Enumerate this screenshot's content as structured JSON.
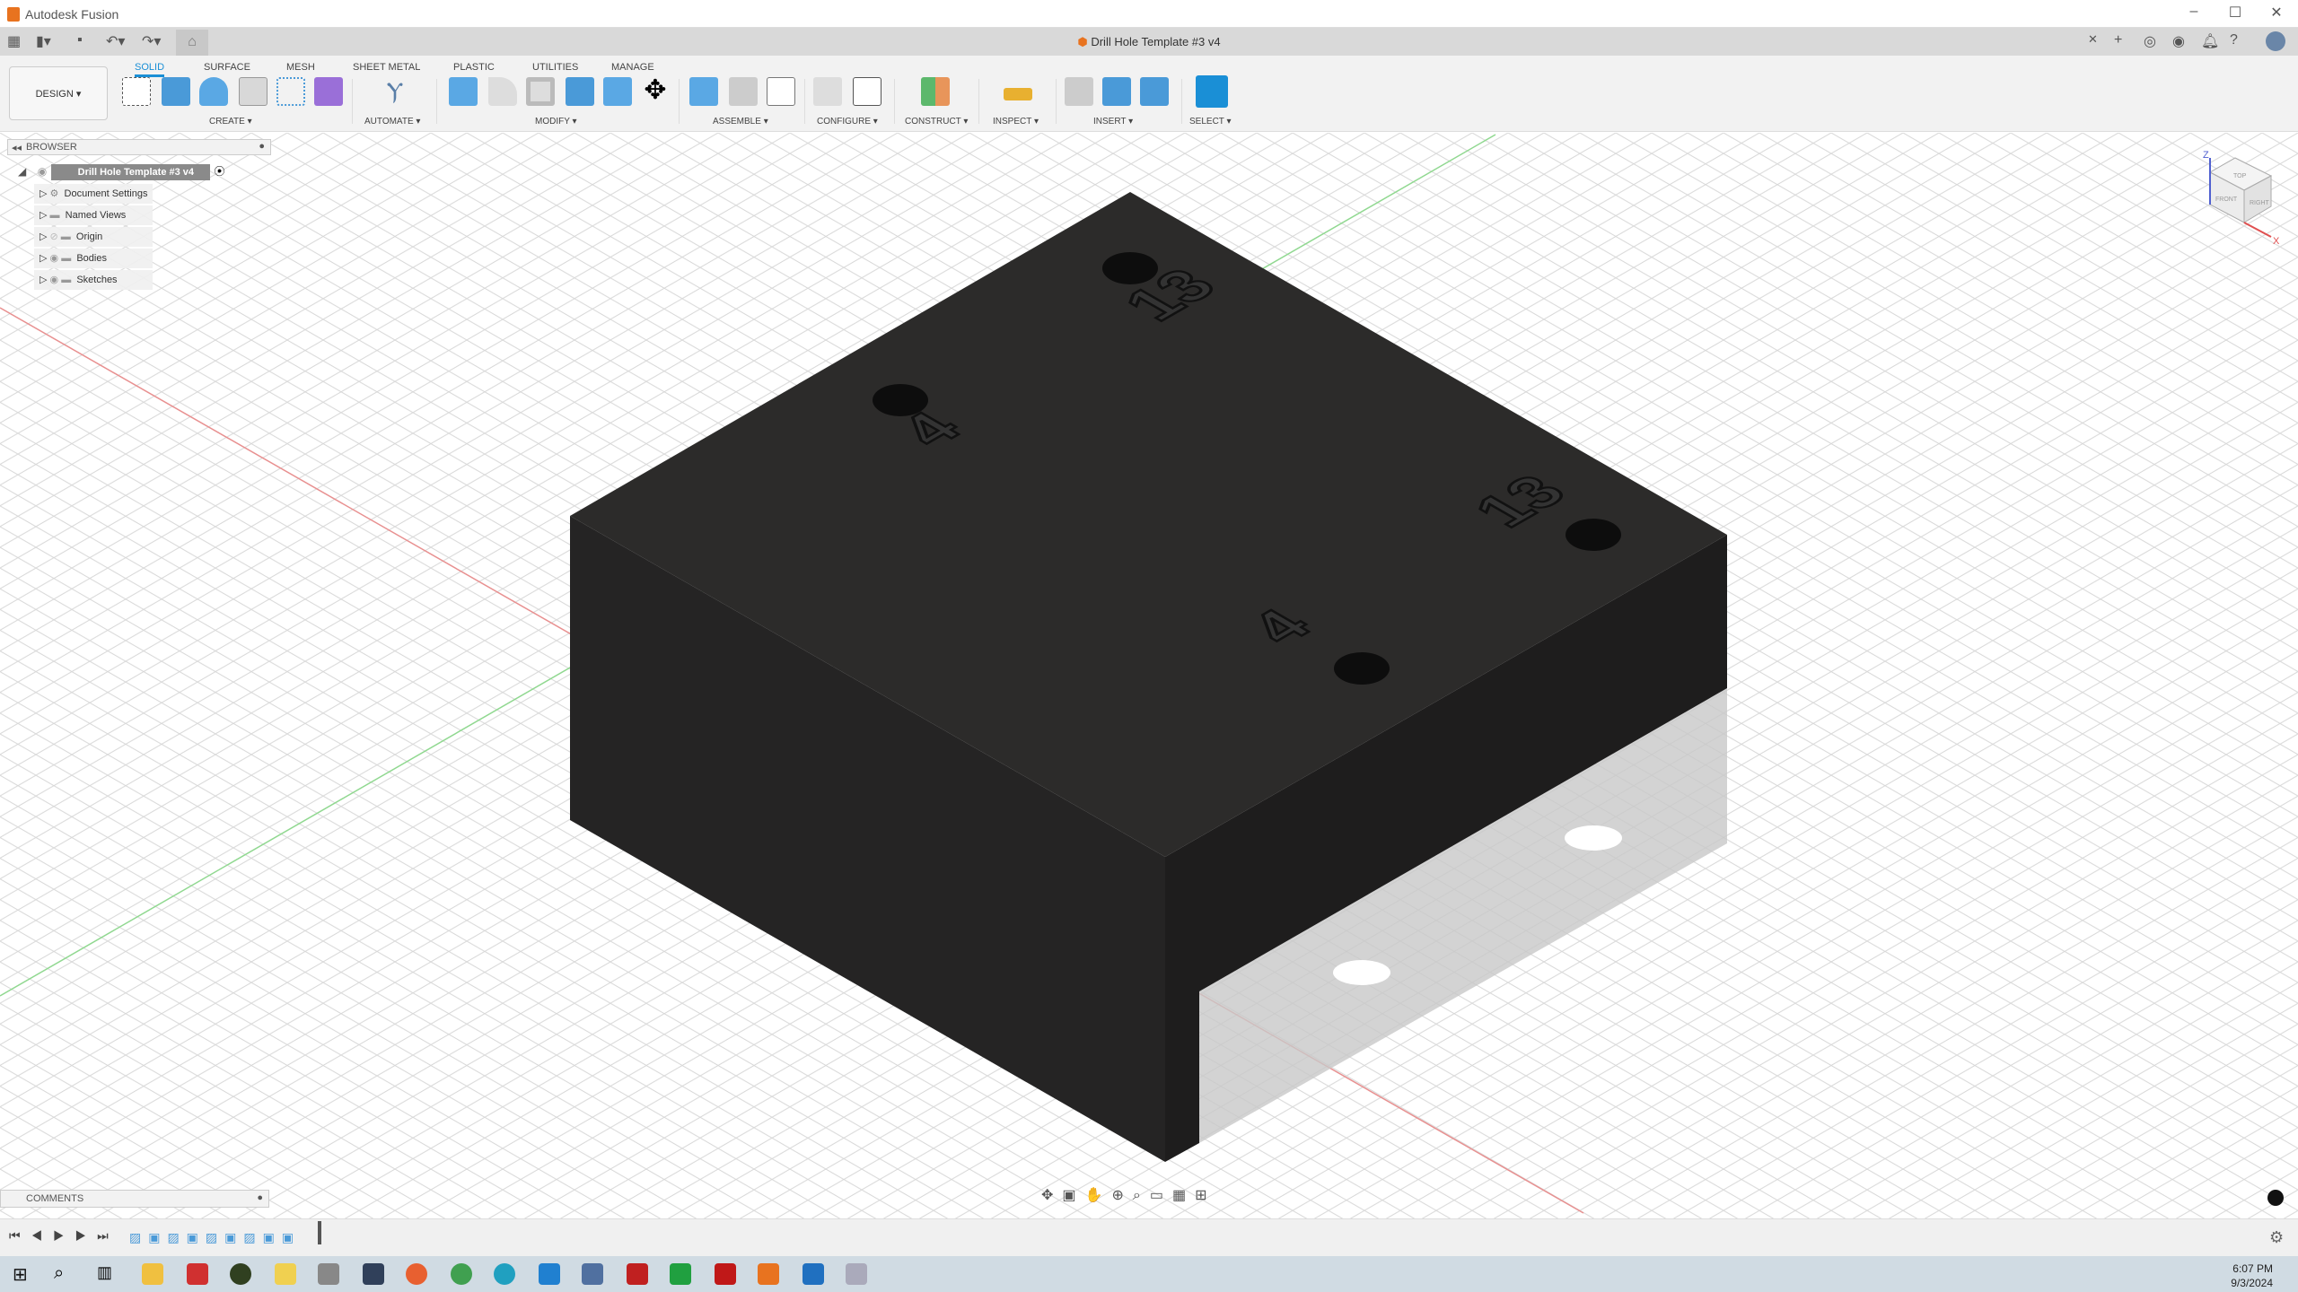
{
  "app": {
    "title": "Autodesk Fusion",
    "document_title": "Drill Hole Template #3 v4"
  },
  "ribbon": {
    "design_label": "DESIGN ▾",
    "tabs": [
      "SOLID",
      "SURFACE",
      "MESH",
      "SHEET METAL",
      "PLASTIC",
      "UTILITIES",
      "MANAGE"
    ],
    "active_tab": "SOLID",
    "groups": [
      "CREATE ▾",
      "AUTOMATE ▾",
      "MODIFY ▾",
      "ASSEMBLE ▾",
      "CONFIGURE ▾",
      "CONSTRUCT ▾",
      "INSPECT ▾",
      "INSERT ▾",
      "SELECT ▾"
    ]
  },
  "browser": {
    "header": "BROWSER",
    "root": "Drill Hole Template #3 v4",
    "items": [
      "Document Settings",
      "Named Views",
      "Origin",
      "Bodies",
      "Sketches"
    ]
  },
  "model": {
    "labels": [
      "13",
      "4",
      "13",
      "4"
    ],
    "body_color": "#2a2928"
  },
  "comments": {
    "label": "COMMENTS"
  },
  "viewcube": {
    "faces": [
      "TOP",
      "FRONT",
      "RIGHT"
    ],
    "axes": [
      "Z",
      "X"
    ]
  },
  "taskbar": {
    "time": "6:07 PM",
    "date": "9/3/2024",
    "apps": [
      "start",
      "search",
      "task-view",
      "file-explorer",
      "app-es",
      "app-green",
      "app-notes",
      "app-tool",
      "app-cube",
      "firefox",
      "chrome",
      "edge",
      "vscode",
      "app-people",
      "filezilla",
      "app-sheets",
      "acrobat",
      "fusion",
      "app-c",
      "app-misc"
    ]
  }
}
